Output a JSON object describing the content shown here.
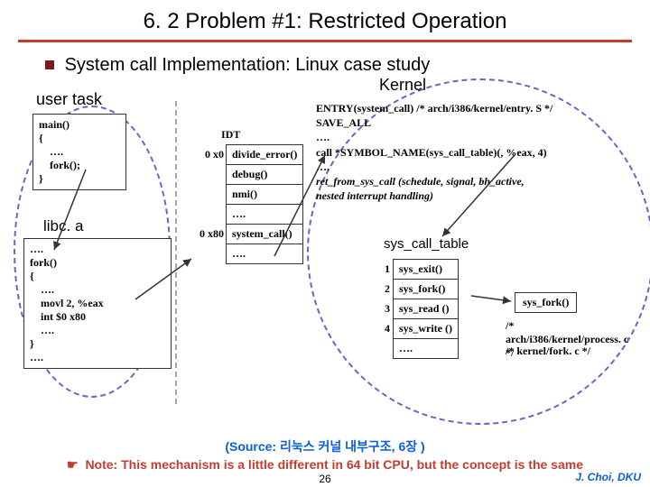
{
  "title": "6. 2 Problem #1: Restricted Operation",
  "subtitle": "System call Implementation: Linux case study",
  "labels": {
    "usertask": "user task",
    "kernel": "Kernel",
    "idt": "IDT",
    "libc": "libc. a",
    "syscall_table": "sys_call_table"
  },
  "main_code": "main()\n{\n    ….\n    fork();\n}",
  "libc_code": "….\nfork()\n{\n    ….\n    movl 2, %eax\n    int $0 x80\n    ….\n}\n….",
  "idt_rows": [
    {
      "addr": "0 x0",
      "label": "divide_error()"
    },
    {
      "addr": "",
      "label": "debug()"
    },
    {
      "addr": "",
      "label": "nmi()"
    },
    {
      "addr": "",
      "label": "…."
    },
    {
      "addr": "0 x80",
      "label": "system_call()"
    },
    {
      "addr": "",
      "label": "…."
    }
  ],
  "entry_lines": [
    "ENTRY(system_call)  /* arch/i386/kernel/entry. S */",
    "    SAVE_ALL",
    "    ….",
    "    call *SYMBOL_NAME(sys_call_table)(, %eax, 4)",
    "    ….",
    "    ret_from_sys_call (schedule, signal, bh_active,",
    "                              nested interrupt handling)"
  ],
  "syscall_rows": [
    {
      "n": "1",
      "fn": "sys_exit()"
    },
    {
      "n": "2",
      "fn": "sys_fork()"
    },
    {
      "n": "3",
      "fn": "sys_read ()"
    },
    {
      "n": "4",
      "fn": "sys_write ()"
    },
    {
      "n": "",
      "fn": "…."
    }
  ],
  "side": {
    "fork": "sys_fork()",
    "comment1": "/* arch/i386/kernel/process. c */",
    "comment2": "/* kernel/fork. c */"
  },
  "footer": {
    "source": "(Source: 리눅스 커널 내부구조, 6장 )",
    "note": "Note: This mechanism is a little different in 64 bit CPU, but the concept is the same",
    "page": "26",
    "credit": "J. Choi, DKU"
  }
}
